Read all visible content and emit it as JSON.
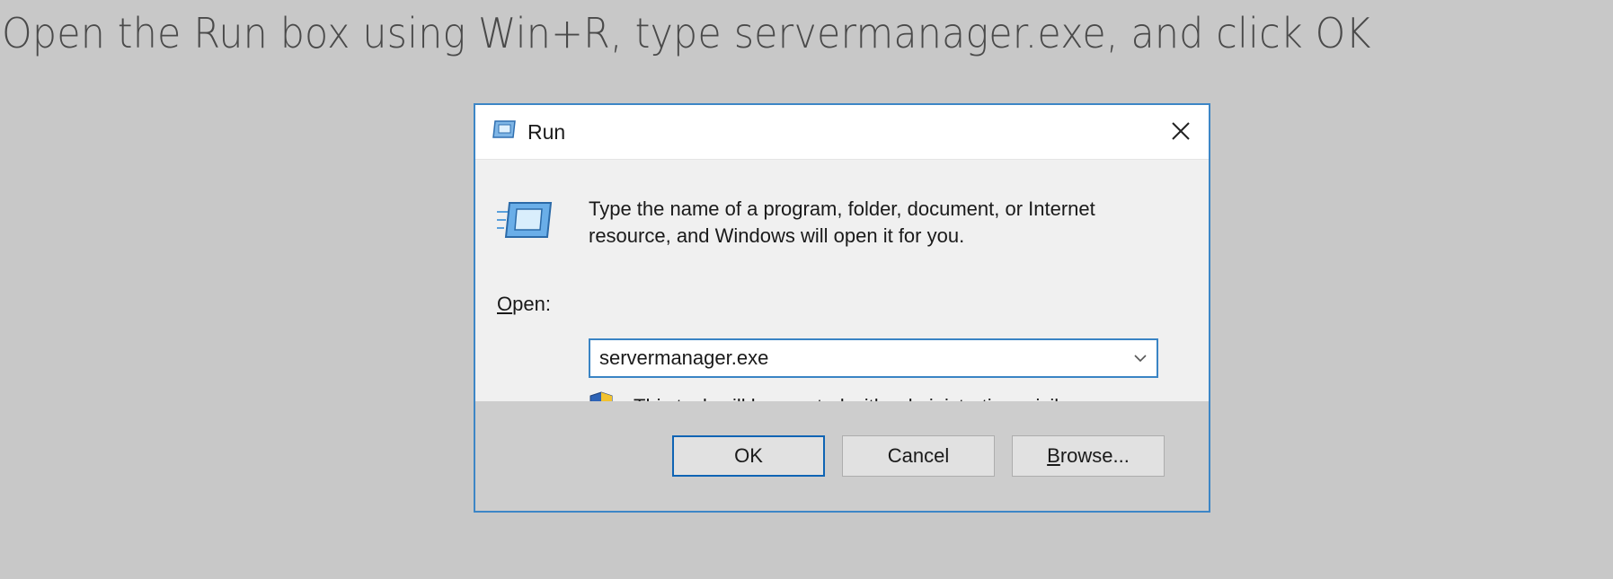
{
  "instruction": {
    "text": "Open the Run box using Win+R, type servermanager.exe, and click OK"
  },
  "dialog": {
    "title": "Run",
    "title_icon": "run-icon",
    "close_icon": "close-icon",
    "description": "Type the name of a program, folder, document, or Internet resource, and Windows will open it for you.",
    "open_label_accesskey": "O",
    "open_label_rest": "pen:",
    "open_value": "servermanager.exe",
    "dropdown_icon": "chevron-down-icon",
    "admin_icon": "uac-shield-icon",
    "admin_note": "This task will be created with administrative privileges.",
    "buttons": {
      "ok": "OK",
      "cancel": "Cancel",
      "browse_accesskey": "B",
      "browse_rest": "rowse..."
    }
  },
  "colors": {
    "background": "#c8c8c8",
    "dialog_border": "#3d86c6",
    "default_button_border": "#0f64b4",
    "footer": "#cdcdcd"
  }
}
